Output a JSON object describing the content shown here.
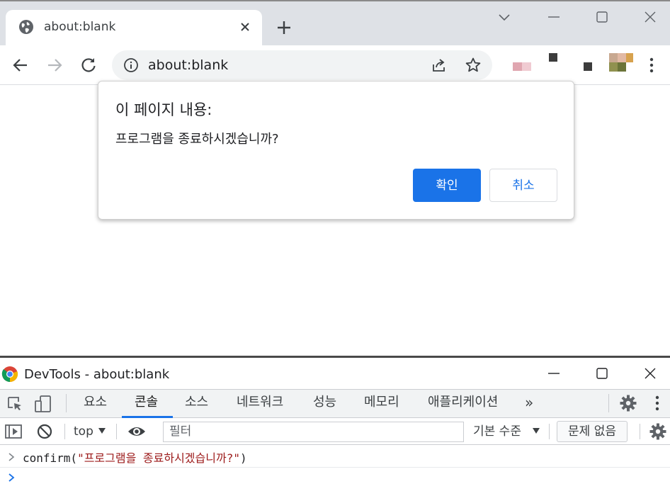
{
  "browser": {
    "tab_title": "about:blank",
    "address": "about:blank"
  },
  "dialog": {
    "title": "이 페이지 내용:",
    "message": "프로그램을 종료하시겠습니까?",
    "ok_label": "확인",
    "cancel_label": "취소"
  },
  "devtools": {
    "window_title": "DevTools - about:blank",
    "tabs": [
      "요소",
      "콘솔",
      "소스",
      "네트워크",
      "성능",
      "메모리",
      "애플리케이션"
    ],
    "more_tabs": "»",
    "console": {
      "context": "top",
      "filter_placeholder": "필터",
      "levels": "기본 수준",
      "issues": "문제 없음",
      "log_fn": "confirm(",
      "log_str": "\"프로그램을 종료하시겠습니까?\"",
      "log_end": ")"
    }
  },
  "colors": {
    "accent": "#1a73e8",
    "chrome_bg": "#dee1e6",
    "string_color": "#9c1a1a"
  },
  "icons": [
    "globe-icon",
    "close-icon",
    "plus-icon",
    "chevron-down-icon",
    "minimize-icon",
    "maximize-icon",
    "back-icon",
    "forward-icon",
    "reload-icon",
    "info-icon",
    "share-icon",
    "star-icon",
    "kebab-menu-icon",
    "chrome-logo-icon",
    "inspect-icon",
    "device-toggle-icon",
    "settings-icon",
    "sidebar-icon",
    "clear-icon",
    "eye-icon",
    "prompt-chevron-icon"
  ]
}
